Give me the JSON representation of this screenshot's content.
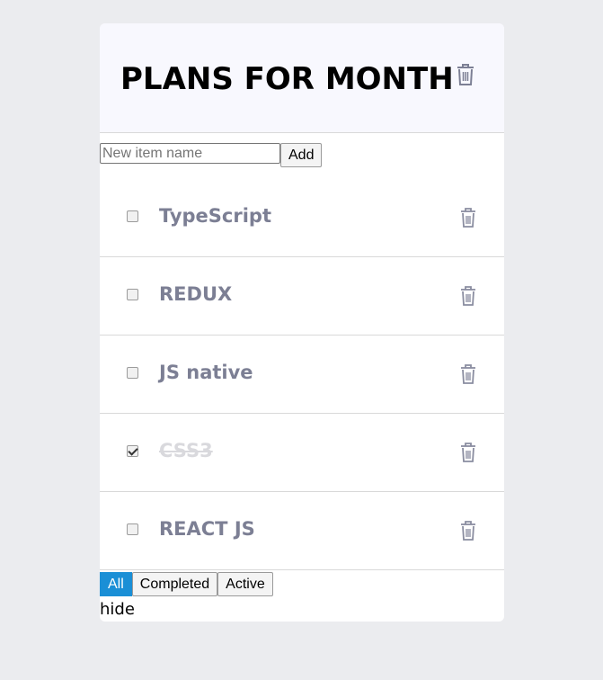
{
  "header": {
    "title": "PLANS FOR MONTH"
  },
  "add_form": {
    "placeholder": "New item name",
    "value": "",
    "add_label": "Add"
  },
  "items": [
    {
      "label": "TypeScript",
      "checked": false
    },
    {
      "label": "REDUX",
      "checked": false
    },
    {
      "label": "JS native",
      "checked": false
    },
    {
      "label": "CSS3",
      "checked": true
    },
    {
      "label": "REACT JS",
      "checked": false
    }
  ],
  "filters": {
    "all": "All",
    "completed": "Completed",
    "active": "Active",
    "selected": "All"
  },
  "footer": {
    "hide_label": "hide"
  },
  "colors": {
    "accent": "#1a8fd6",
    "text_muted": "#7c7f94",
    "done": "#d9d9dd",
    "background": "#ebecef"
  }
}
